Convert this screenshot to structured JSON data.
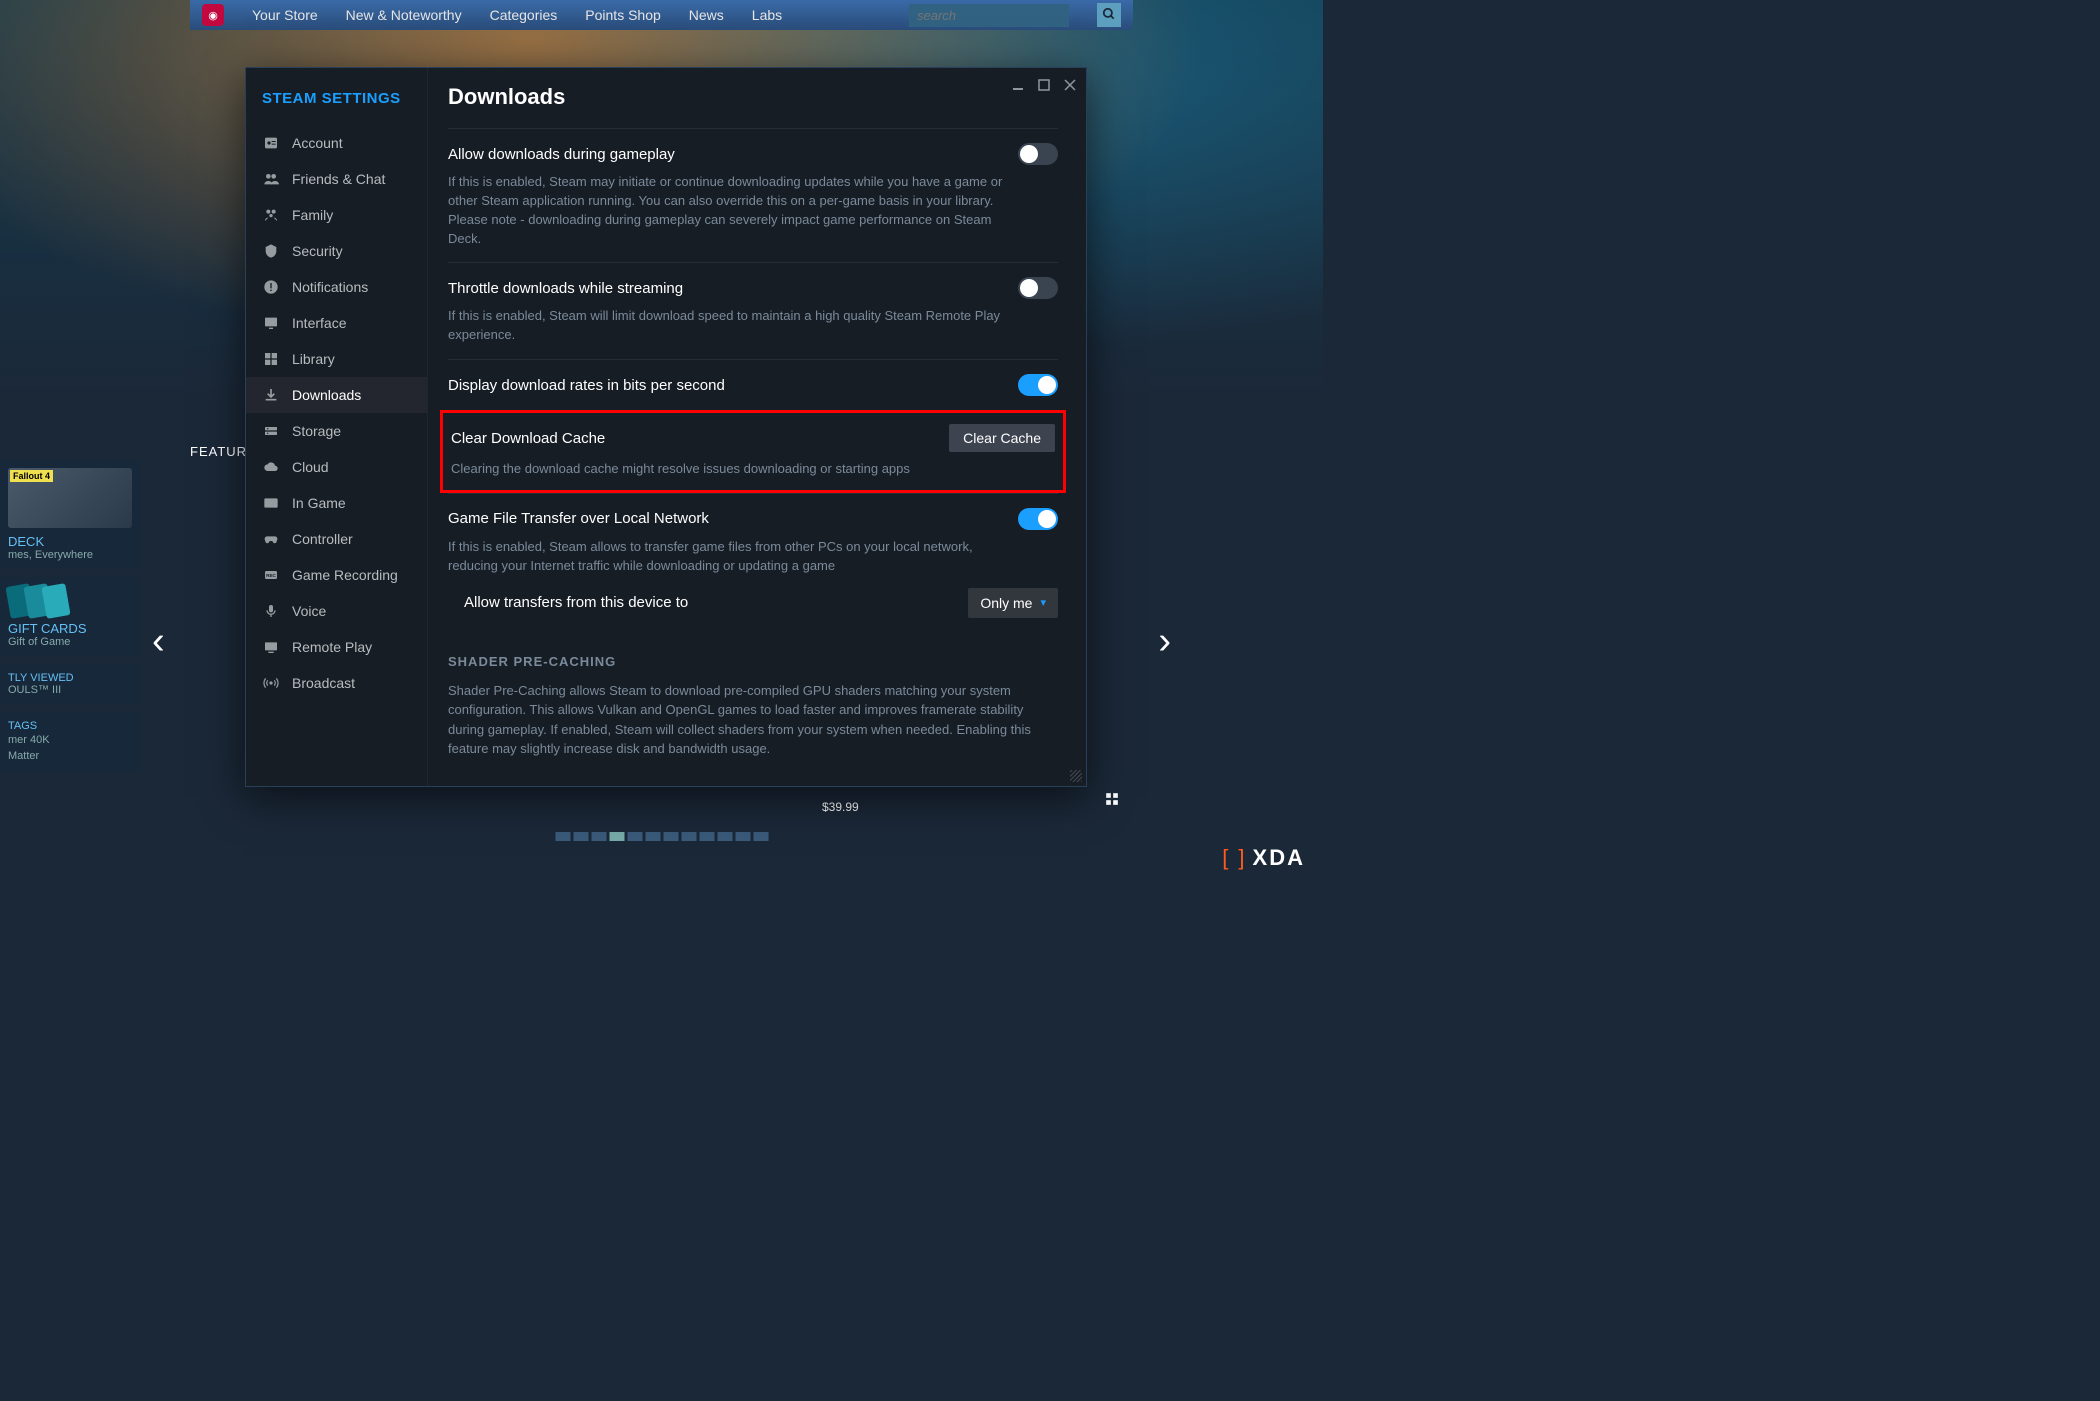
{
  "topnav": {
    "items": [
      "Your Store",
      "New & Noteworthy",
      "Categories",
      "Points Shop",
      "News",
      "Labs"
    ],
    "search_placeholder": "search"
  },
  "store_bg": {
    "featured_label": "FEATUR",
    "deck_title": "DECK",
    "deck_sub": "mes, Everywhere",
    "fallout_label": "Fallout 4",
    "giftcards_title": "GIFT CARDS",
    "giftcards_sub": "Gift of Game",
    "recently_viewed": "TLY VIEWED",
    "recently_item": "OULS™ III",
    "tags_header": "TAGS",
    "tags": [
      "mer 40K",
      "Matter"
    ],
    "price": "$39.99"
  },
  "modal": {
    "sidebar_title": "STEAM SETTINGS",
    "sidebar": [
      {
        "icon": "account",
        "label": "Account"
      },
      {
        "icon": "friends",
        "label": "Friends & Chat"
      },
      {
        "icon": "family",
        "label": "Family"
      },
      {
        "icon": "security",
        "label": "Security"
      },
      {
        "icon": "notifications",
        "label": "Notifications"
      },
      {
        "icon": "interface",
        "label": "Interface"
      },
      {
        "icon": "library",
        "label": "Library"
      },
      {
        "icon": "downloads",
        "label": "Downloads"
      },
      {
        "icon": "storage",
        "label": "Storage"
      },
      {
        "icon": "cloud",
        "label": "Cloud"
      },
      {
        "icon": "ingame",
        "label": "In Game"
      },
      {
        "icon": "controller",
        "label": "Controller"
      },
      {
        "icon": "recording",
        "label": "Game Recording"
      },
      {
        "icon": "voice",
        "label": "Voice"
      },
      {
        "icon": "remoteplay",
        "label": "Remote Play"
      },
      {
        "icon": "broadcast",
        "label": "Broadcast"
      }
    ],
    "active_index": 7,
    "page_title": "Downloads",
    "settings": {
      "allow_during_gameplay": {
        "title": "Allow downloads during gameplay",
        "desc": "If this is enabled, Steam may initiate or continue downloading updates while you have a game or other Steam application running. You can also override this on a per-game basis in your library. Please note - downloading during gameplay can severely impact game performance on Steam Deck.",
        "enabled": false
      },
      "throttle_streaming": {
        "title": "Throttle downloads while streaming",
        "desc": "If this is enabled, Steam will limit download speed to maintain a high quality Steam Remote Play experience.",
        "enabled": false
      },
      "bits_per_second": {
        "title": "Display download rates in bits per second",
        "enabled": true
      },
      "clear_cache": {
        "title": "Clear Download Cache",
        "button": "Clear Cache",
        "desc": "Clearing the download cache might resolve issues downloading or starting apps"
      },
      "local_transfer": {
        "title": "Game File Transfer over Local Network",
        "desc": "If this is enabled, Steam allows to transfer game files from other PCs on your local network, reducing your Internet traffic while downloading or updating a game",
        "enabled": true,
        "sub_label": "Allow transfers from this device to",
        "sub_value": "Only me"
      },
      "shader_precaching": {
        "header": "SHADER PRE-CACHING",
        "desc": "Shader Pre-Caching allows Steam to download pre-compiled GPU shaders matching your system configuration. This allows Vulkan and OpenGL games to load faster and improves framerate stability during gameplay. If enabled, Steam will collect shaders from your system when needed. Enabling this feature may slightly increase disk and bandwidth usage."
      }
    }
  },
  "watermark": "XDA"
}
